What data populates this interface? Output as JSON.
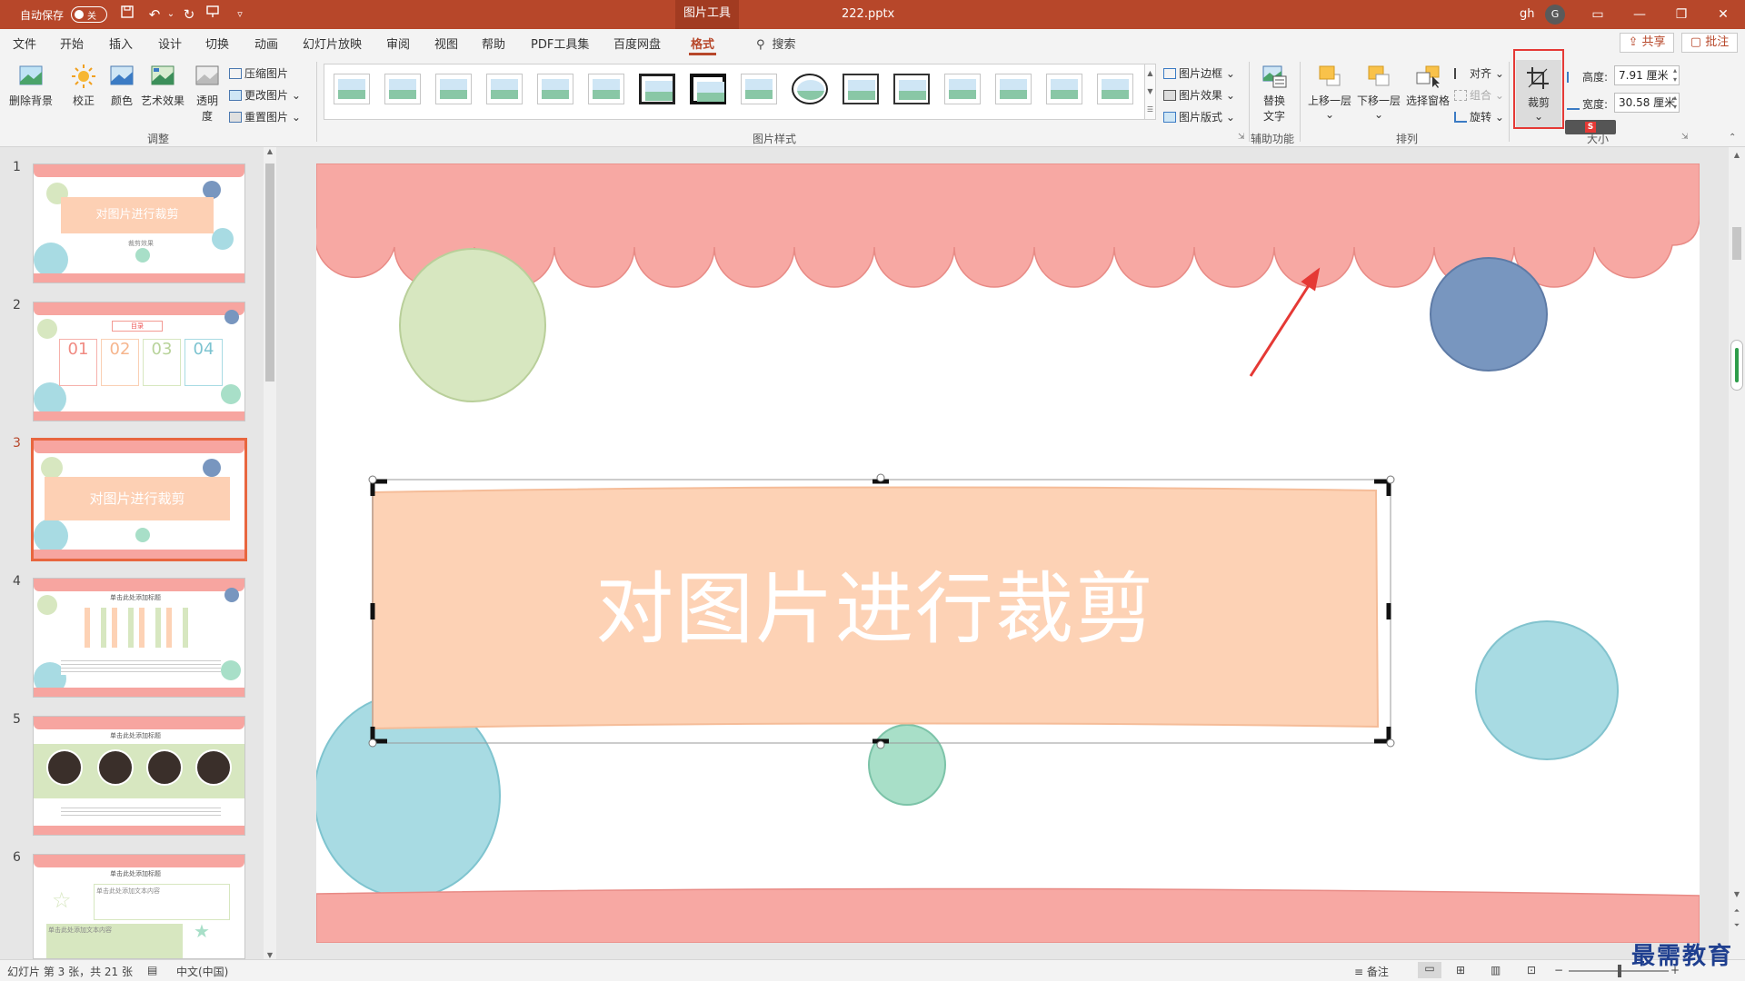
{
  "titlebar": {
    "autosave_label": "自动保存",
    "autosave_state": "关",
    "context_tab": "图片工具",
    "filename": "222.pptx",
    "user": "gh",
    "avatar_letter": "G",
    "bar_color": "#b7472a"
  },
  "menu": {
    "tabs": [
      "文件",
      "开始",
      "插入",
      "设计",
      "切换",
      "动画",
      "幻灯片放映",
      "审阅",
      "视图",
      "帮助",
      "PDF工具集",
      "百度网盘",
      "格式"
    ],
    "active_tab": "格式",
    "search": "搜索",
    "share": "共享",
    "comment": "批注"
  },
  "ribbon": {
    "adjust": {
      "remove_bg": "删除背景",
      "correct": "校正",
      "color": "颜色",
      "artistic": "艺术效果",
      "transparency_1": "透明",
      "transparency_2": "度",
      "compress": "压缩图片",
      "change": "更改图片",
      "reset": "重置图片",
      "label": "调整"
    },
    "styles": {
      "border": "图片边框",
      "effects": "图片效果",
      "layout": "图片版式",
      "label": "图片样式"
    },
    "accessibility": {
      "alt_text_1": "替换",
      "alt_text_2": "文字",
      "label": "辅助功能"
    },
    "arrange": {
      "bring_forward": "上移一层",
      "send_backward": "下移一层",
      "selection_pane": "选择窗格",
      "align": "对齐",
      "group": "组合",
      "rotate": "旋转",
      "label": "排列"
    },
    "size": {
      "crop": "裁剪",
      "height_label": "高度:",
      "height_value": "7.91 厘米",
      "width_label": "宽度:",
      "width_value": "30.58 厘米",
      "label": "大小"
    }
  },
  "slides": [
    {
      "number": "1",
      "title": "对图片进行裁剪",
      "subtitle": "裁剪效果"
    },
    {
      "number": "2",
      "title": "目录",
      "items": [
        "01",
        "02",
        "03",
        "04"
      ]
    },
    {
      "number": "3",
      "title": "对图片进行裁剪"
    },
    {
      "number": "4",
      "title": "单击此处添加标题"
    },
    {
      "number": "5",
      "title": "单击此处添加标题"
    },
    {
      "number": "6",
      "title": "单击此处添加标题",
      "text_1": "单击此处添加文本内容",
      "text_2": "单击此处添加文本内容"
    }
  ],
  "active_slide": "3",
  "main_slide": {
    "title": "对图片进行裁剪",
    "colors": {
      "scallop": "#f7a8a3",
      "banner": "#fdd2b5",
      "green": "#d7e7c0",
      "blue": "#7896bf",
      "cyan": "#a8dbe3",
      "mint": "#a8dfc8"
    }
  },
  "statusbar": {
    "slide_info": "幻灯片 第 3 张，共 21 张",
    "language": "中文(中国)",
    "notes": "备注",
    "zoom": "119%"
  },
  "watermark": "最需教育"
}
